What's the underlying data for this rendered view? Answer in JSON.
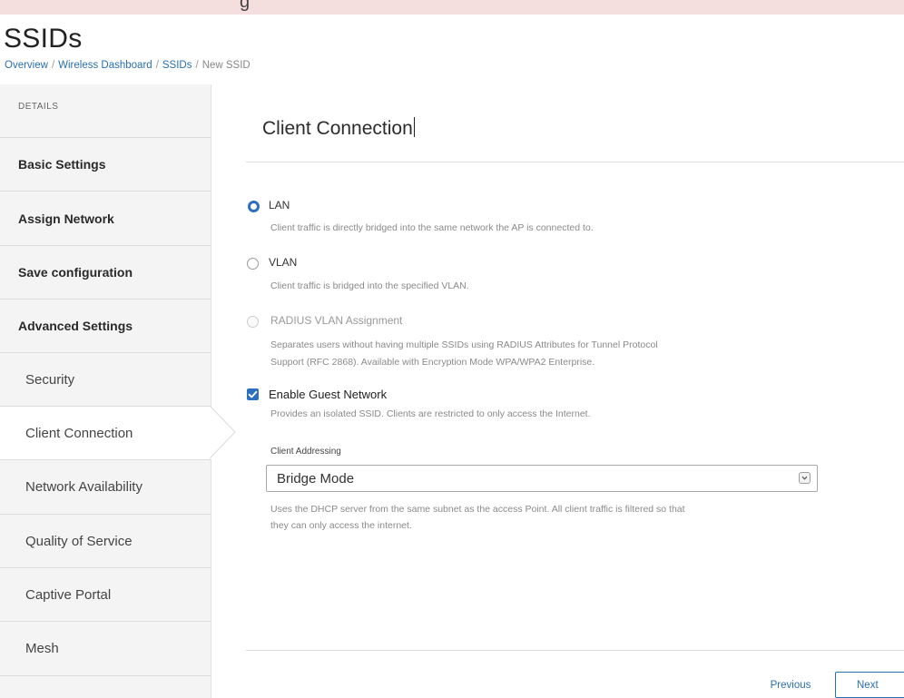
{
  "top_strip": {
    "text": "g"
  },
  "page": {
    "title": "SSIDs",
    "breadcrumb": {
      "items": [
        "Overview",
        "Wireless Dashboard",
        "SSIDs"
      ],
      "current": "New SSID",
      "separator": "/"
    }
  },
  "sidebar": {
    "header": "DETAILS",
    "items": [
      {
        "label": "Basic Settings",
        "level": "main"
      },
      {
        "label": "Assign Network",
        "level": "main"
      },
      {
        "label": "Save configuration",
        "level": "main"
      },
      {
        "label": "Advanced Settings",
        "level": "main"
      },
      {
        "label": "Security",
        "level": "sub"
      },
      {
        "label": "Client Connection",
        "level": "sub",
        "active": true
      },
      {
        "label": "Network Availability",
        "level": "sub"
      },
      {
        "label": "Quality of Service",
        "level": "sub"
      },
      {
        "label": "Captive Portal",
        "level": "sub"
      },
      {
        "label": "Mesh",
        "level": "sub"
      }
    ]
  },
  "content": {
    "title": "Client Connection",
    "options": [
      {
        "label": "LAN",
        "description": "Client traffic is directly bridged into the same network the AP is connected to.",
        "selected": true,
        "disabled": false
      },
      {
        "label": "VLAN",
        "description": "Client traffic is bridged into the specified VLAN.",
        "selected": false,
        "disabled": false
      },
      {
        "label": "RADIUS VLAN Assignment",
        "description_line1": "Separates users without having multiple SSIDs using RADIUS Attributes for Tunnel Protocol",
        "description_line2": "Support (RFC 2868). Available with Encryption Mode WPA/WPA2 Enterprise.",
        "selected": false,
        "disabled": true
      }
    ],
    "guest_network": {
      "label": "Enable Guest Network",
      "checked": true,
      "description": "Provides an isolated SSID. Clients are restricted to only access the Internet."
    },
    "client_addressing": {
      "label": "Client Addressing",
      "value": "Bridge Mode",
      "help_line1": "Uses the DHCP server from the same subnet as the access Point. All client traffic is filtered so that",
      "help_line2": "they can only access the internet."
    }
  },
  "footer": {
    "previous_label": "Previous",
    "next_label": "Next"
  },
  "colors": {
    "accent": "#2c6fc0",
    "link": "#2a6fb0",
    "sidebar_bg": "#f4f4f4",
    "top_strip": "#f5dede"
  },
  "icons": {
    "select_toggle": "chevron-down-icon",
    "checkbox_mark": "check-icon"
  }
}
